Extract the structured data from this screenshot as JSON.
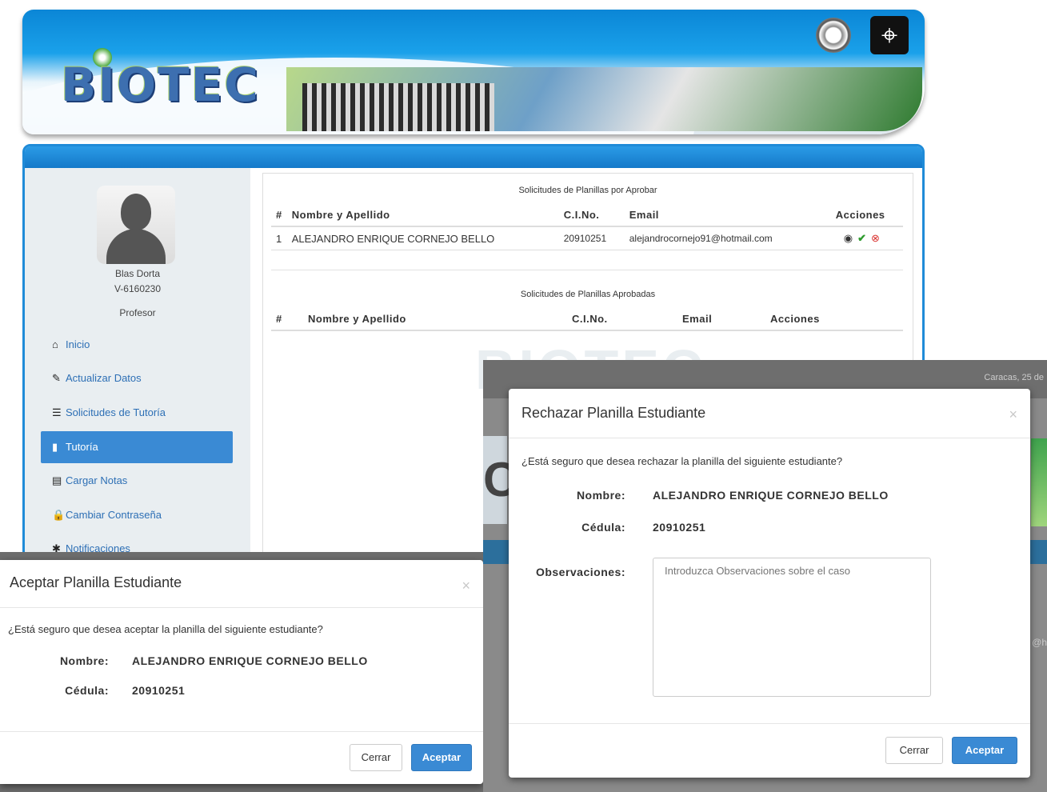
{
  "banner": {
    "logo_text": "BIOTEC",
    "emblem_icon": "map-emblem-icon",
    "seal_icon": "university-seal-icon"
  },
  "profile": {
    "name": "Blas Dorta",
    "id": "V-6160230",
    "role": "Profesor"
  },
  "nav": [
    {
      "label": "Inicio",
      "icon": "home-icon",
      "glyph": "⌂",
      "active": false
    },
    {
      "label": "Actualizar Datos",
      "icon": "edit-icon",
      "glyph": "✎",
      "active": false
    },
    {
      "label": "Solicitudes de Tutoría",
      "icon": "list-icon",
      "glyph": "☰",
      "active": false
    },
    {
      "label": "Tutoría",
      "icon": "book-icon",
      "glyph": "▮",
      "active": true
    },
    {
      "label": "Cargar Notas",
      "icon": "document-icon",
      "glyph": "▤",
      "active": false
    },
    {
      "label": "Cambiar Contraseña",
      "icon": "lock-icon",
      "glyph": "🔒",
      "active": false
    },
    {
      "label": "Notificaciones",
      "icon": "asterisk-icon",
      "glyph": "✱",
      "active": false
    }
  ],
  "pending": {
    "title": "Solicitudes de Planillas por Aprobar",
    "headers": [
      "#",
      "Nombre y Apellido",
      "C.I.No.",
      "Email",
      "Acciones"
    ],
    "rows": [
      {
        "num": "1",
        "name": "ALEJANDRO ENRIQUE CORNEJO BELLO",
        "ci": "20910251",
        "email": "alejandrocornejo91@hotmail.com"
      }
    ]
  },
  "approved": {
    "title": "Solicitudes de Planillas Aprobadas",
    "headers": [
      "#",
      "Nombre y Apellido",
      "C.I.No.",
      "Email",
      "Acciones"
    ]
  },
  "reject_modal": {
    "title": "Rechazar Planilla Estudiante",
    "close": "×",
    "question": "¿Está seguro que desea rechazar la planilla del siguiente estudiante?",
    "name_label": "Nombre:",
    "name_value": "ALEJANDRO ENRIQUE CORNEJO BELLO",
    "cedula_label": "Cédula:",
    "cedula_value": "20910251",
    "obs_label": "Observaciones:",
    "obs_placeholder": "Introduzca Observaciones sobre el caso",
    "close_button": "Cerrar",
    "accept_button": "Aceptar",
    "background_date": "Caracas, 25 de",
    "background_email": "@h"
  },
  "accept_modal": {
    "title": "Aceptar Planilla Estudiante",
    "close": "×",
    "question": "¿Está seguro que desea aceptar la planilla del siguiente estudiante?",
    "name_label": "Nombre:",
    "name_value": "ALEJANDRO ENRIQUE CORNEJO BELLO",
    "cedula_label": "Cédula:",
    "cedula_value": "20910251",
    "close_button": "Cerrar",
    "accept_button": "Aceptar"
  },
  "colors": {
    "primary": "#3a8ad4",
    "header_blue": "#1f8bd8",
    "accept_green": "#2e9b2e",
    "reject_red": "#d9322f"
  }
}
